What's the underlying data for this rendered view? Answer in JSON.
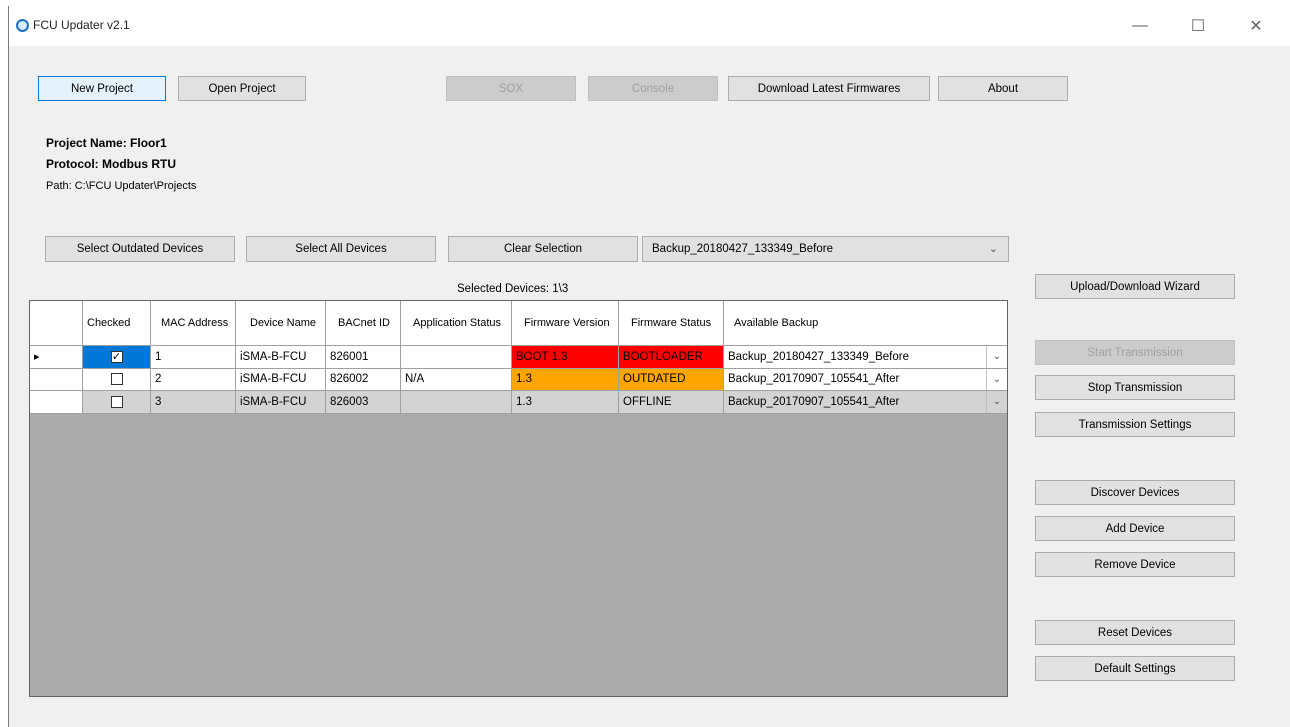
{
  "window": {
    "title": "FCU Updater v2.1"
  },
  "toolbar": {
    "new_project": "New Project",
    "open_project": "Open Project",
    "sox": "SOX",
    "console": "Console",
    "download_firmwares": "Download Latest Firmwares",
    "about": "About"
  },
  "project": {
    "name_line": "Project Name: Floor1",
    "protocol_line": "Protocol: Modbus RTU",
    "path_line": "Path: C:\\FCU Updater\\Projects"
  },
  "selection": {
    "select_outdated": "Select Outdated Devices",
    "select_all": "Select All Devices",
    "clear": "Clear Selection",
    "backup_combo_value": "Backup_20180427_133349_Before",
    "selected_count": "Selected Devices: 1\\3"
  },
  "table": {
    "headers": [
      "",
      "Checked",
      "MAC Address",
      "Device Name",
      "BACnet ID",
      "Application Status",
      "Firmware Version",
      "Firmware Status",
      "Available Backup"
    ],
    "rows": [
      {
        "current": true,
        "checked": true,
        "mac": "1",
        "device": "iSMA-B-FCU",
        "bacnet": "826001",
        "app_status": "",
        "fw_version": "BOOT 1.3",
        "fw_status": "BOOTLOADER",
        "backup": "Backup_20180427_133349_Before",
        "fw_color": "#ff0000",
        "row_bg": "#ffffff"
      },
      {
        "current": false,
        "checked": false,
        "mac": "2",
        "device": "iSMA-B-FCU",
        "bacnet": "826002",
        "app_status": "N/A",
        "fw_version": "1.3",
        "fw_status": "OUTDATED",
        "backup": "Backup_20170907_105541_After",
        "fw_color": "#ffa500",
        "row_bg": "#ffffff"
      },
      {
        "current": false,
        "checked": false,
        "mac": "3",
        "device": "iSMA-B-FCU",
        "bacnet": "826003",
        "app_status": "",
        "fw_version": "1.3",
        "fw_status": "OFFLINE",
        "backup": "Backup_20170907_105541_After",
        "fw_color": "#d3d3d3",
        "row_bg": "#d3d3d3"
      }
    ]
  },
  "side": {
    "wizard": "Upload/Download Wizard",
    "start": "Start Transmission",
    "stop": "Stop Transmission",
    "settings": "Transmission Settings",
    "discover": "Discover Devices",
    "add": "Add Device",
    "remove": "Remove Device",
    "reset": "Reset Devices",
    "defaults": "Default Settings"
  },
  "icons": {
    "app": "app-logo-icon",
    "minimize": "minimize-icon",
    "maximize": "maximize-icon",
    "close": "close-icon"
  }
}
